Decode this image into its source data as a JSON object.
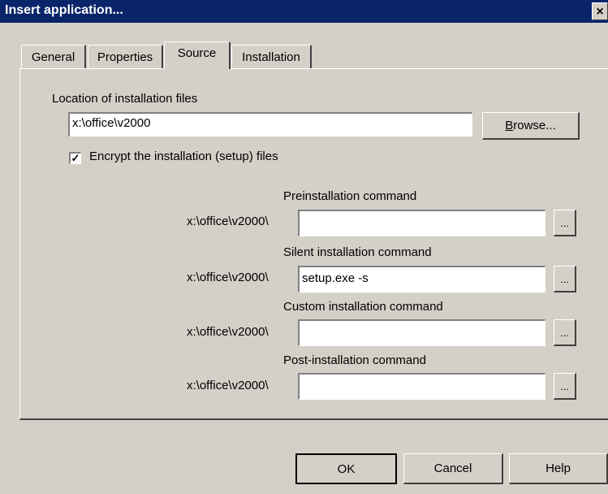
{
  "window": {
    "title": "Insert application...",
    "close_glyph": "×"
  },
  "tabs": [
    {
      "label": "General"
    },
    {
      "label": "Properties"
    },
    {
      "label": "Source"
    },
    {
      "label": "Installation"
    }
  ],
  "location": {
    "label": "Location of installation files",
    "value": "x:\\office\\v2000",
    "browse_label_underlined": "B",
    "browse_label_rest": "rowse..."
  },
  "encrypt": {
    "label": "Encrypt the installation (setup) files",
    "checked": true,
    "check_glyph": "✓"
  },
  "commands": [
    {
      "label": "Preinstallation command",
      "prefix": "x:\\office\\v2000\\",
      "value": "",
      "button": "..."
    },
    {
      "label": "Silent installation command",
      "prefix": "x:\\office\\v2000\\",
      "value": "setup.exe -s",
      "button": "..."
    },
    {
      "label": "Custom installation command",
      "prefix": "x:\\office\\v2000\\",
      "value": "",
      "button": "..."
    },
    {
      "label": "Post-installation command",
      "prefix": "x:\\office\\v2000\\",
      "value": "",
      "button": "..."
    }
  ],
  "footer": {
    "ok": "OK",
    "cancel": "Cancel",
    "help": "Help"
  }
}
